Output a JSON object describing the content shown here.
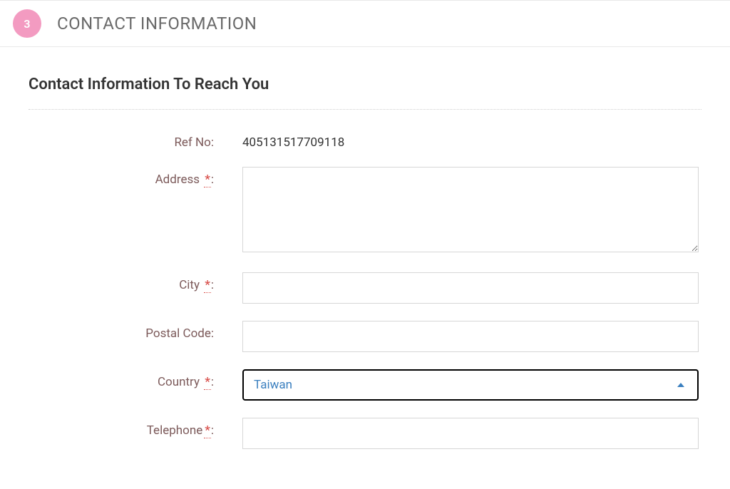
{
  "header": {
    "step_number": "3",
    "title": "CONTACT INFORMATION"
  },
  "section": {
    "subtitle": "Contact Information To Reach You"
  },
  "fields": {
    "refno": {
      "label": "Ref No:",
      "value": "405131517709118"
    },
    "address": {
      "label": "Address ",
      "suffix": ":",
      "value": ""
    },
    "city": {
      "label": "City ",
      "suffix": ":",
      "value": ""
    },
    "postal": {
      "label": "Postal Code:",
      "value": ""
    },
    "country": {
      "label": "Country ",
      "suffix": ":",
      "selected": "Taiwan"
    },
    "telephone": {
      "label": "Telephone",
      "suffix": ":",
      "value": ""
    }
  },
  "required_marker": "*"
}
